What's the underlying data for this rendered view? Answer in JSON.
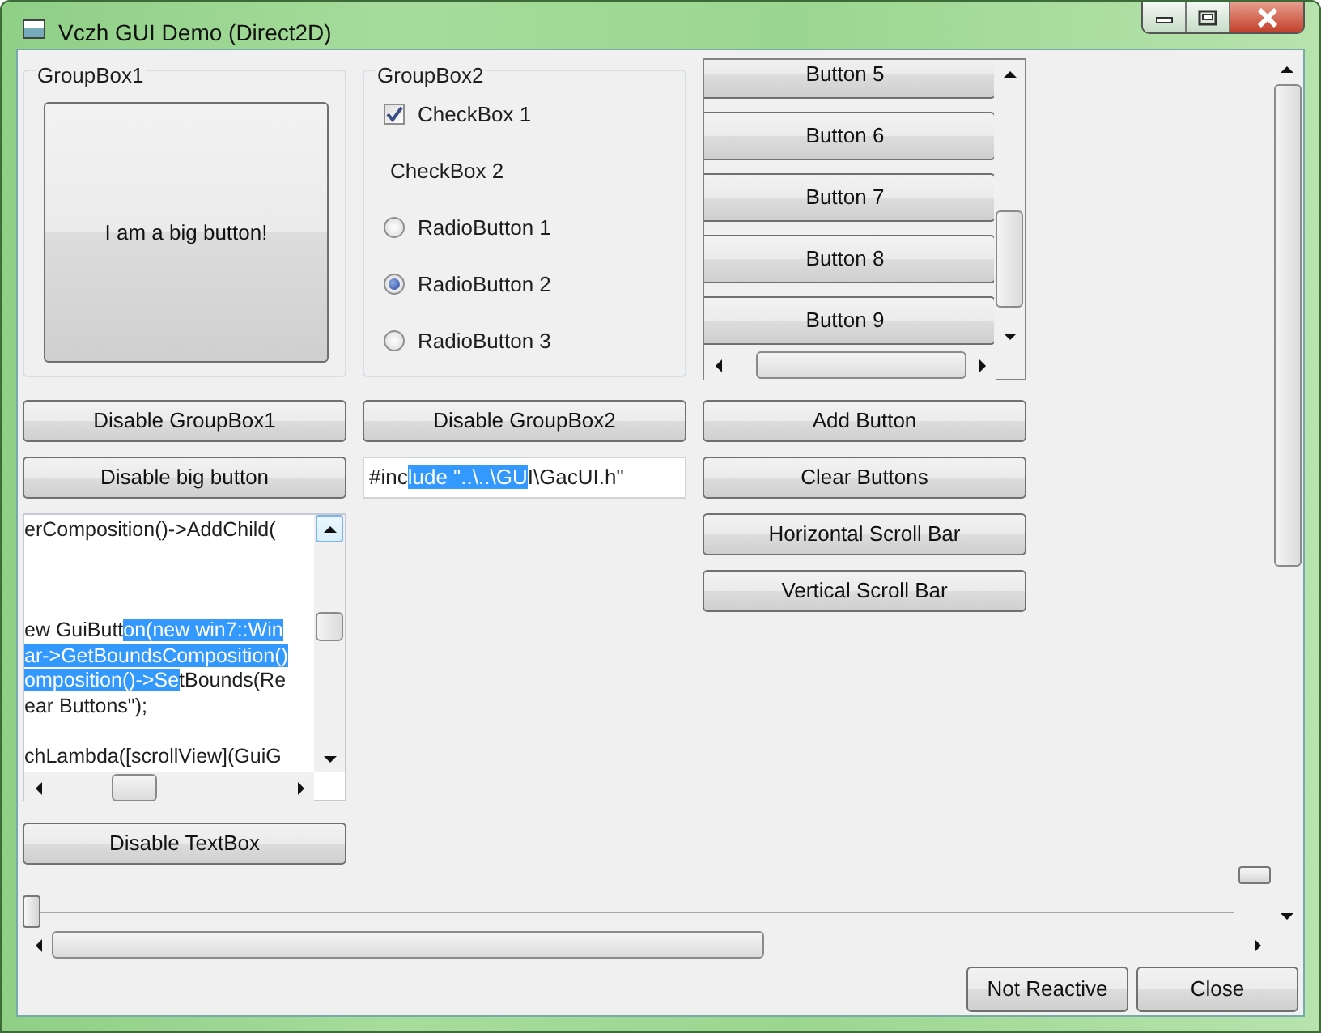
{
  "window": {
    "title": "Vczh GUI Demo (Direct2D)"
  },
  "group_box_1": {
    "title": "GroupBox1",
    "big_button": "I am a big button!"
  },
  "column_1_buttons": [
    "Disable GroupBox1",
    "Disable big button"
  ],
  "text_box": {
    "lines": [
      {
        "kind": "text",
        "segments": [
          {
            "text": "erComposition()->AddChild(",
            "selected": false
          }
        ]
      },
      {
        "kind": "blank"
      },
      {
        "kind": "blank"
      },
      {
        "kind": "blank"
      },
      {
        "kind": "text",
        "segments": [
          {
            "text": "ew GuiButt",
            "selected": false
          },
          {
            "text": "on(new win7::Win",
            "selected": true
          }
        ]
      },
      {
        "kind": "text",
        "segments": [
          {
            "text": "ar->GetBoundsComposition()",
            "selected": true
          }
        ]
      },
      {
        "kind": "text",
        "segments": [
          {
            "text": "omposition()->Se",
            "selected": true
          },
          {
            "text": "tBounds(Re",
            "selected": false
          }
        ]
      },
      {
        "kind": "text",
        "segments": [
          {
            "text": "ear Buttons\");",
            "selected": false
          }
        ]
      },
      {
        "kind": "blank"
      },
      {
        "kind": "text",
        "segments": [
          {
            "text": "chLambda([scrollView](GuiG",
            "selected": false
          }
        ]
      }
    ]
  },
  "column_1_bottom_button": "Disable TextBox",
  "group_box_2": {
    "title": "GroupBox2",
    "items": [
      {
        "kind": "checkbox",
        "label": "CheckBox 1",
        "checked": true
      },
      {
        "kind": "plain",
        "label": "CheckBox 2"
      },
      {
        "kind": "radio",
        "label": "RadioButton 1",
        "selected": false
      },
      {
        "kind": "radio",
        "label": "RadioButton 2",
        "selected": true
      },
      {
        "kind": "radio",
        "label": "RadioButton 3",
        "selected": false
      }
    ]
  },
  "column_2_button": "Disable GroupBox2",
  "text_field": {
    "segments": [
      {
        "text": "#inc",
        "selected": false
      },
      {
        "text": "lude \"..\\..\\GU",
        "selected": true
      },
      {
        "text": "I\\GacUI.h\"",
        "selected": false
      }
    ]
  },
  "scroll_view": {
    "buttons": [
      "Button 5",
      "Button 6",
      "Button 7",
      "Button 8",
      "Button 9"
    ]
  },
  "column_3_buttons": [
    "Add Button",
    "Clear Buttons",
    "Horizontal Scroll Bar",
    "Vertical Scroll Bar"
  ],
  "horizontal_tracker": {
    "level": 0
  },
  "vertical_tracker": {
    "level": 0
  },
  "footer_buttons": [
    "Not Reactive",
    "Close"
  ]
}
